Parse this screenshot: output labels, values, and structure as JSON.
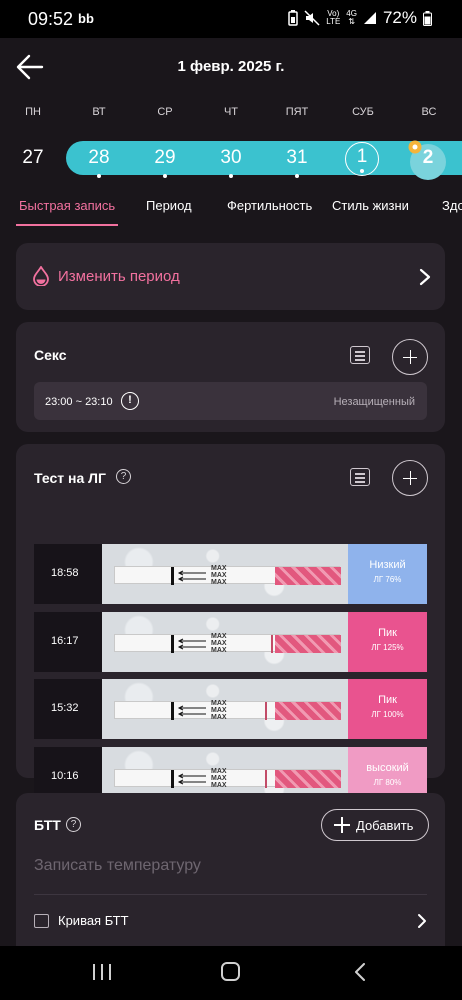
{
  "status_bar": {
    "time": "09:52",
    "app_badge": "bb",
    "signal_top": "Vo)",
    "signal_bottom": "LTE",
    "network": "4G",
    "battery": "72%"
  },
  "header": {
    "title": "1 февр. 2025 г."
  },
  "calendar": {
    "weekdays": [
      "ПН",
      "ВТ",
      "СР",
      "ЧТ",
      "ПЯТ",
      "СУБ",
      "ВС"
    ],
    "dates": [
      "27",
      "28",
      "29",
      "30",
      "31",
      "1",
      "2"
    ],
    "today": "1",
    "selected": "2",
    "band_color": "#3bc2cf"
  },
  "tabs": [
    "Быстрая запись",
    "Период",
    "Фертильность",
    "Стиль жизни",
    "Здо"
  ],
  "active_tab": "Быстрая запись",
  "period": {
    "label": "Изменить период"
  },
  "sex": {
    "title": "Секс",
    "entry": {
      "time": "23:00 ~ 23:10",
      "status": "Незащищенный"
    }
  },
  "lh_test": {
    "title": "Тест на ЛГ",
    "strip_label": "MAX",
    "entries": [
      {
        "time": "18:58",
        "level": "Низкий",
        "value": "ЛГ 76%",
        "color": "#8fb3ec"
      },
      {
        "time": "16:17",
        "level": "Пик",
        "value": "ЛГ 125%",
        "color": "#e9538f"
      },
      {
        "time": "15:32",
        "level": "Пик",
        "value": "ЛГ 100%",
        "color": "#e9538f"
      },
      {
        "time": "10:16",
        "level": "высокий",
        "value": "ЛГ 80%",
        "color": "#f09bc4"
      }
    ]
  },
  "btt": {
    "title": "БТТ",
    "add_label": "Добавить",
    "input_placeholder": "Записать температуру",
    "curve_label": "Кривая БТТ"
  },
  "colors": {
    "accent": "#f2719f",
    "card": "#2a242c",
    "background": "#1a161b"
  }
}
